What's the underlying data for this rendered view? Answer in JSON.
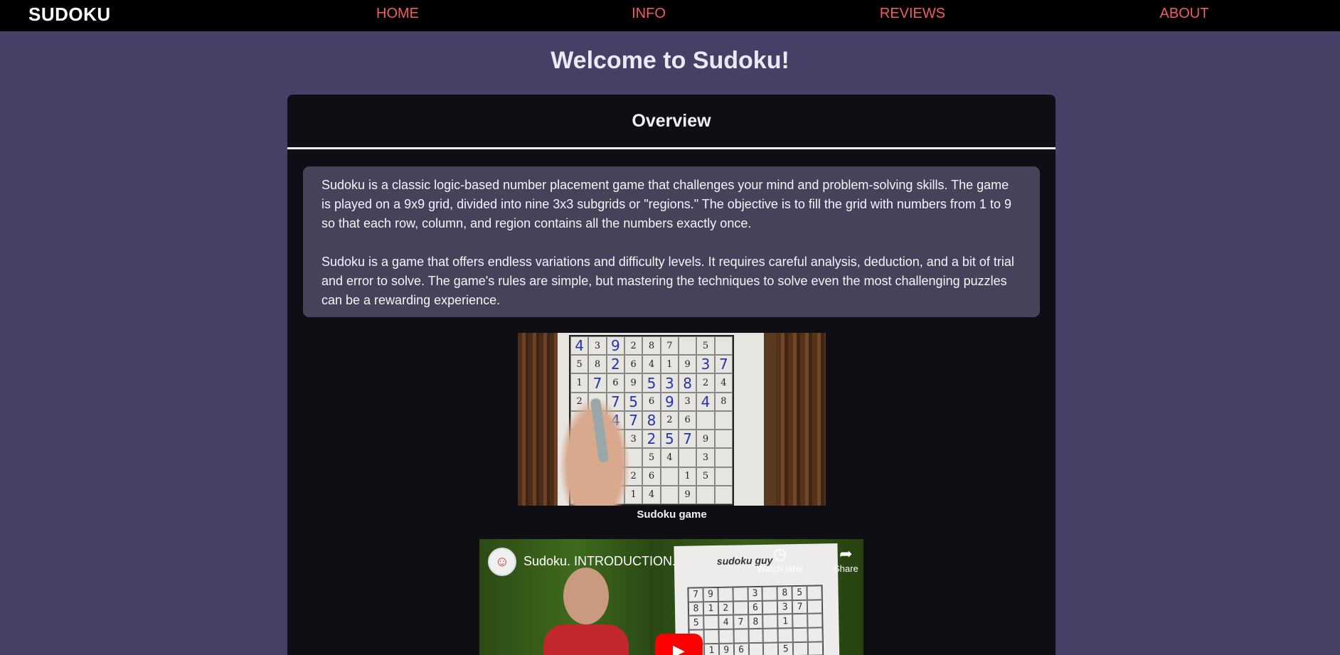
{
  "nav": {
    "brand": "SUDOKU",
    "links": [
      {
        "label": "HOME"
      },
      {
        "label": "INFO"
      },
      {
        "label": "REVIEWS"
      },
      {
        "label": "ABOUT"
      }
    ]
  },
  "page": {
    "title": "Welcome to Sudoku!"
  },
  "overview": {
    "heading": "Overview",
    "paragraphs": [
      "Sudoku is a classic logic-based number placement game that challenges your mind and problem-solving skills. The game is played on a 9x9 grid, divided into nine 3x3 subgrids or \"regions.\" The objective is to fill the grid with numbers from 1 to 9 so that each row, column, and region contains all the numbers exactly once.",
      "Sudoku is a game that offers endless variations and difficulty levels. It requires careful analysis, deduction, and a bit of trial and error to solve. The game's rules are simple, but mastering the techniques to solve even the most challenging puzzles can be a rewarding experience."
    ]
  },
  "figure": {
    "caption": "Sudoku game"
  },
  "video": {
    "title": "Sudoku. INTRODUCTION.",
    "watch_later": "Watch later",
    "share": "Share",
    "channel_mark": "sudoku guy"
  },
  "colors": {
    "background": "#464066",
    "nav_link": "#f25d5d",
    "card": "#0f0e14",
    "text_box": "#45435a",
    "play_button": "#ff0000"
  }
}
